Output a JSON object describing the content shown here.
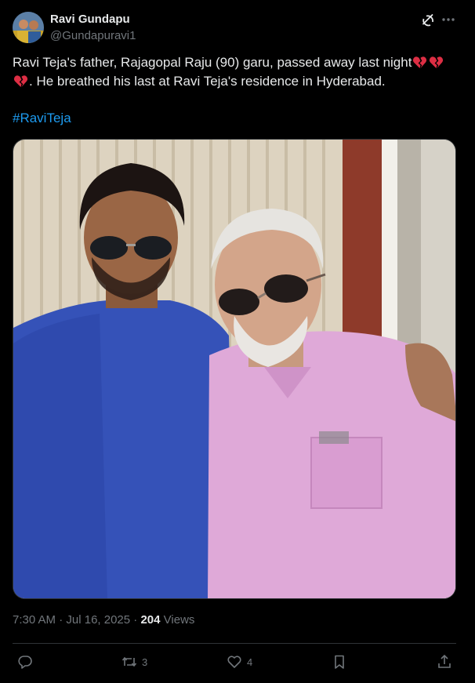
{
  "author": {
    "name": "Ravi Gundapu",
    "handle": "@Gundapuravi1",
    "avatar_icon": "profile-avatar"
  },
  "tweet": {
    "line1_text": "Ravi Teja's father, Rajagopal Raju (90) garu, passed away last night",
    "line2_text": ". He breathed his last at Ravi Teja's residence in Hyderabad.",
    "hashtag": "#RaviTeja",
    "emoji": "broken-heart-icon",
    "photo_icon": "photo-two-men"
  },
  "meta": {
    "time": "7:30 AM",
    "separator": "·",
    "date": "Jul 16, 2025",
    "views_count": "204",
    "views_label": "Views"
  },
  "actions": {
    "reply_count": "",
    "retweet_count": "3",
    "like_count": "4"
  },
  "colors": {
    "background": "#000000",
    "text": "#e7e9ea",
    "muted": "#71767b",
    "link": "#1d9bf0",
    "divider": "#2f3336"
  }
}
